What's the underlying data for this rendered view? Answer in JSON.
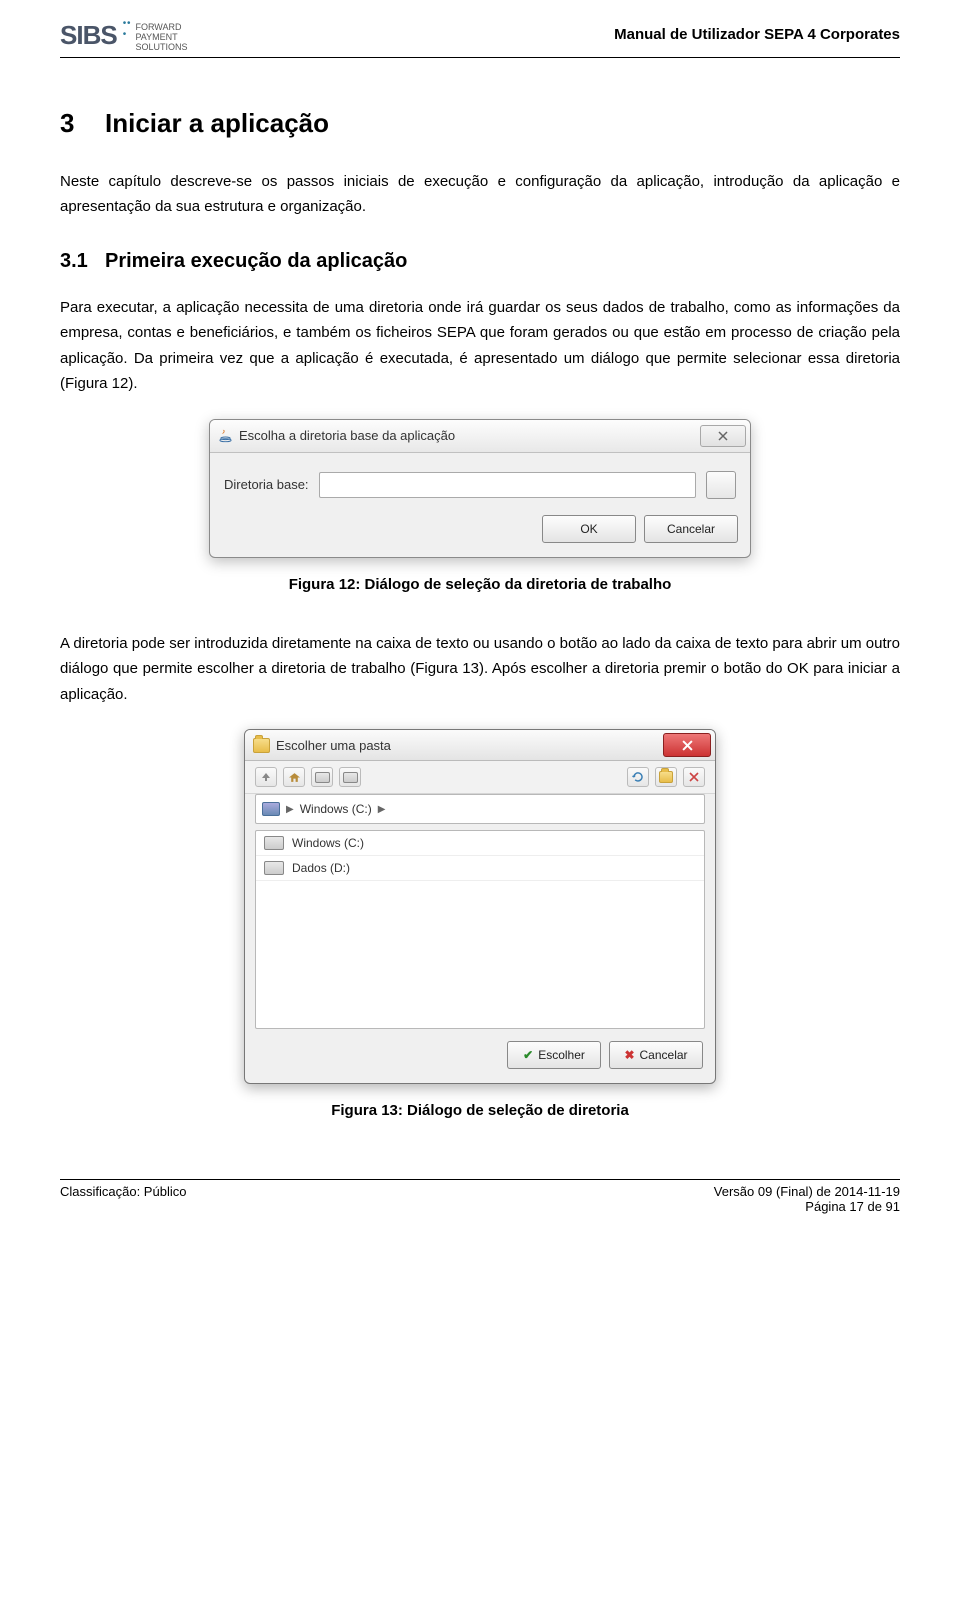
{
  "header": {
    "logo_main": "SIBS",
    "logo_tag_l1": "FORWARD",
    "logo_tag_l2": "PAYMENT",
    "logo_tag_l3": "SOLUTIONS",
    "doc_title": "Manual de Utilizador SEPA 4 Corporates"
  },
  "section": {
    "h1_num": "3",
    "h1_text": "Iniciar a aplicação",
    "p1": "Neste capítulo descreve-se os passos iniciais de execução e configuração da aplicação, introdução da aplicação e apresentação da sua estrutura e organização.",
    "h2_num": "3.1",
    "h2_text": "Primeira execução da aplicação",
    "p2": "Para executar, a aplicação necessita de uma diretoria onde irá guardar os seus dados de trabalho, como as informações da empresa, contas e beneficiários, e também os ficheiros SEPA que foram gerados ou que estão em processo de criação pela aplicação. Da primeira vez que a aplicação é executada, é apresentado um diálogo que permite selecionar essa diretoria (Figura 12).",
    "fig12_caption": "Figura 12: Diálogo de seleção da diretoria de trabalho",
    "p3": "A diretoria pode ser introduzida diretamente na caixa de texto ou usando o botão ao lado da caixa de texto para abrir um outro diálogo que permite escolher a diretoria de trabalho (Figura 13). Após escolher a diretoria premir o botão do OK para iniciar a aplicação.",
    "fig13_caption": "Figura 13: Diálogo de seleção de diretoria"
  },
  "dialog1": {
    "title": "Escolha a diretoria base da aplicação",
    "label": "Diretoria base:",
    "ok": "OK",
    "cancel": "Cancelar"
  },
  "dialog2": {
    "title": "Escolher uma pasta",
    "breadcrumb": "Windows (C:)",
    "drives": [
      "Windows (C:)",
      "Dados (D:)"
    ],
    "choose": "Escolher",
    "cancel": "Cancelar"
  },
  "footer": {
    "classification": "Classificação: Público",
    "version": "Versão 09 (Final) de 2014-11-19",
    "page": "Página 17 de 91"
  }
}
